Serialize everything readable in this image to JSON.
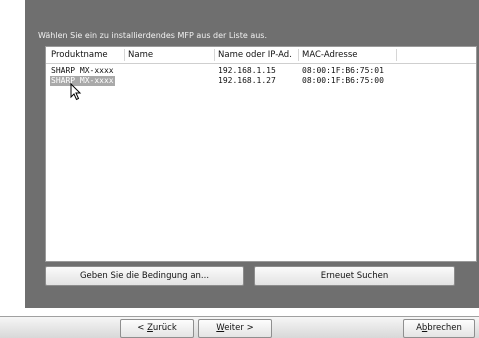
{
  "dialog": {
    "instruction": "Wählen Sie ein zu installierdendes MFP aus der Liste aus."
  },
  "listview": {
    "columns": [
      "Produktname",
      "Name",
      "Name oder IP-Ad...",
      "MAC-Adresse"
    ],
    "rows": [
      {
        "product": "SHARP MX-xxxx",
        "name": "",
        "ip": "192.168.1.15",
        "mac": "08:00:1F:B6:75:01"
      },
      {
        "product": "SHARP MX-xxxx",
        "name": "",
        "ip": "192.168.1.27",
        "mac": "08:00:1F:B6:75:00"
      }
    ]
  },
  "actions": {
    "condition_label": "Geben Sie die Bedingung an...",
    "search_again_label": "Erneuet Suchen"
  },
  "wizard": {
    "back": {
      "prefix": "< ",
      "mnemonic": "Z",
      "rest": "urück"
    },
    "next": {
      "mnemonic": "W",
      "rest": "eiter >"
    },
    "cancel": {
      "prefix": "A",
      "mnemonic": "b",
      "rest": "brechen"
    }
  },
  "colors": {
    "panel": "#6f6f6f",
    "selection": "#a9a9a9"
  },
  "icons": [
    "mouse-pointer-icon"
  ]
}
